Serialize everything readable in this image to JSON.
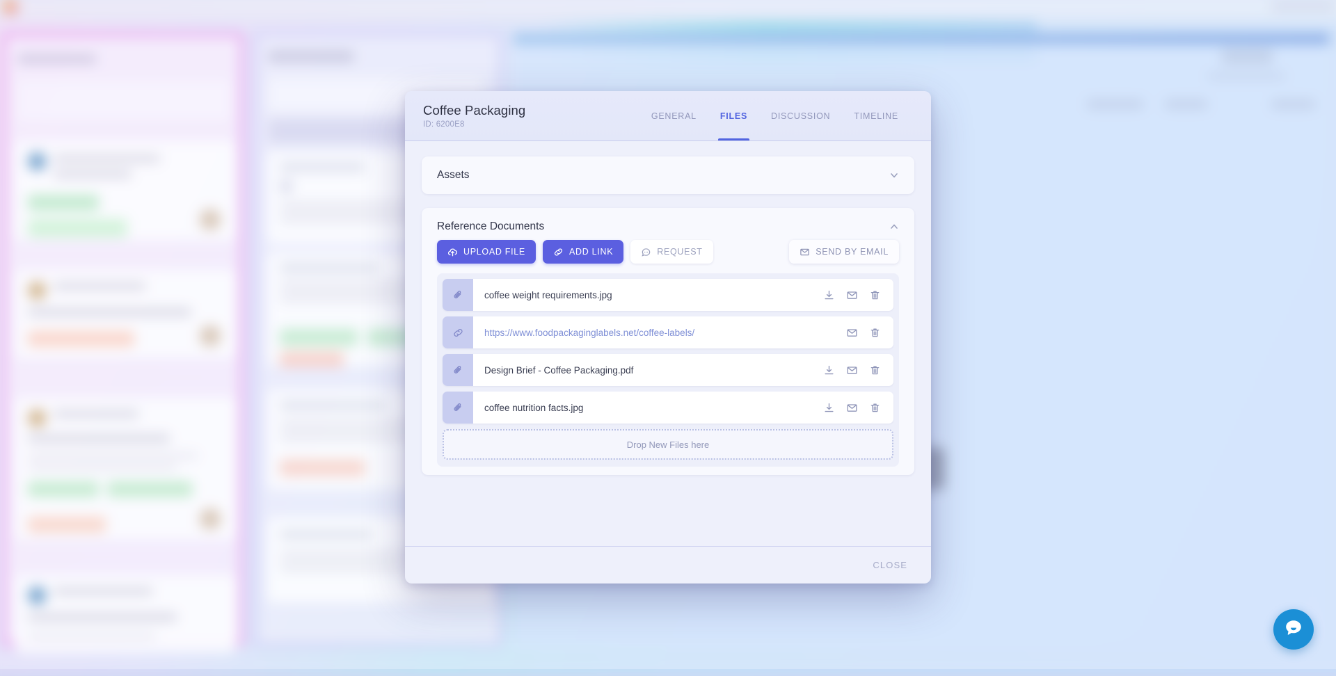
{
  "background": {
    "note": "blurred project board behind modal",
    "topbar": {
      "logo_icon": "app-logo-icon"
    },
    "chat_widget_icon": "chat-bubble-icon"
  },
  "modal": {
    "title": "Coffee Packaging",
    "id_label": "ID: 6200E8",
    "tabs": [
      {
        "label": "GENERAL",
        "active": false
      },
      {
        "label": "FILES",
        "active": true
      },
      {
        "label": "DISCUSSION",
        "active": false
      },
      {
        "label": "TIMELINE",
        "active": false
      }
    ],
    "sections": {
      "assets": {
        "title": "Assets",
        "expanded": false,
        "chevron_icon": "chevron-down-icon"
      },
      "reference_documents": {
        "title": "Reference Documents",
        "expanded": true,
        "chevron_icon": "chevron-up-icon",
        "actions": [
          {
            "label": "UPLOAD FILE",
            "icon": "upload-cloud-icon",
            "style": "primary"
          },
          {
            "label": "ADD LINK",
            "icon": "link-icon",
            "style": "primary"
          },
          {
            "label": "REQUEST",
            "icon": "comment-icon",
            "style": "ghost"
          }
        ],
        "secondary_action": {
          "label": "SEND BY EMAIL",
          "icon": "envelope-icon"
        },
        "files": [
          {
            "name": "coffee weight requirements.jpg",
            "type": "file",
            "icon": "paperclip-icon",
            "actions": [
              "download-icon",
              "envelope-icon",
              "trash-icon"
            ]
          },
          {
            "name": "https://www.foodpackaginglabels.net/coffee-labels/",
            "type": "link",
            "icon": "link-icon",
            "actions": [
              "envelope-icon",
              "trash-icon"
            ]
          },
          {
            "name": "Design Brief - Coffee Packaging.pdf",
            "type": "file",
            "icon": "paperclip-icon",
            "actions": [
              "download-icon",
              "envelope-icon",
              "trash-icon"
            ]
          },
          {
            "name": "coffee nutrition facts.jpg",
            "type": "file",
            "icon": "paperclip-icon",
            "actions": [
              "download-icon",
              "envelope-icon",
              "trash-icon"
            ]
          }
        ],
        "dropzone_text": "Drop New Files here"
      }
    },
    "footer": {
      "close_label": "CLOSE"
    }
  },
  "colors": {
    "primary": "#5b5fe0",
    "tab_active": "#5264e0",
    "link_text": "#7f8fd6",
    "file_icon_bg": "#c8cdf0",
    "chat_widget": "#1b8fd6"
  }
}
